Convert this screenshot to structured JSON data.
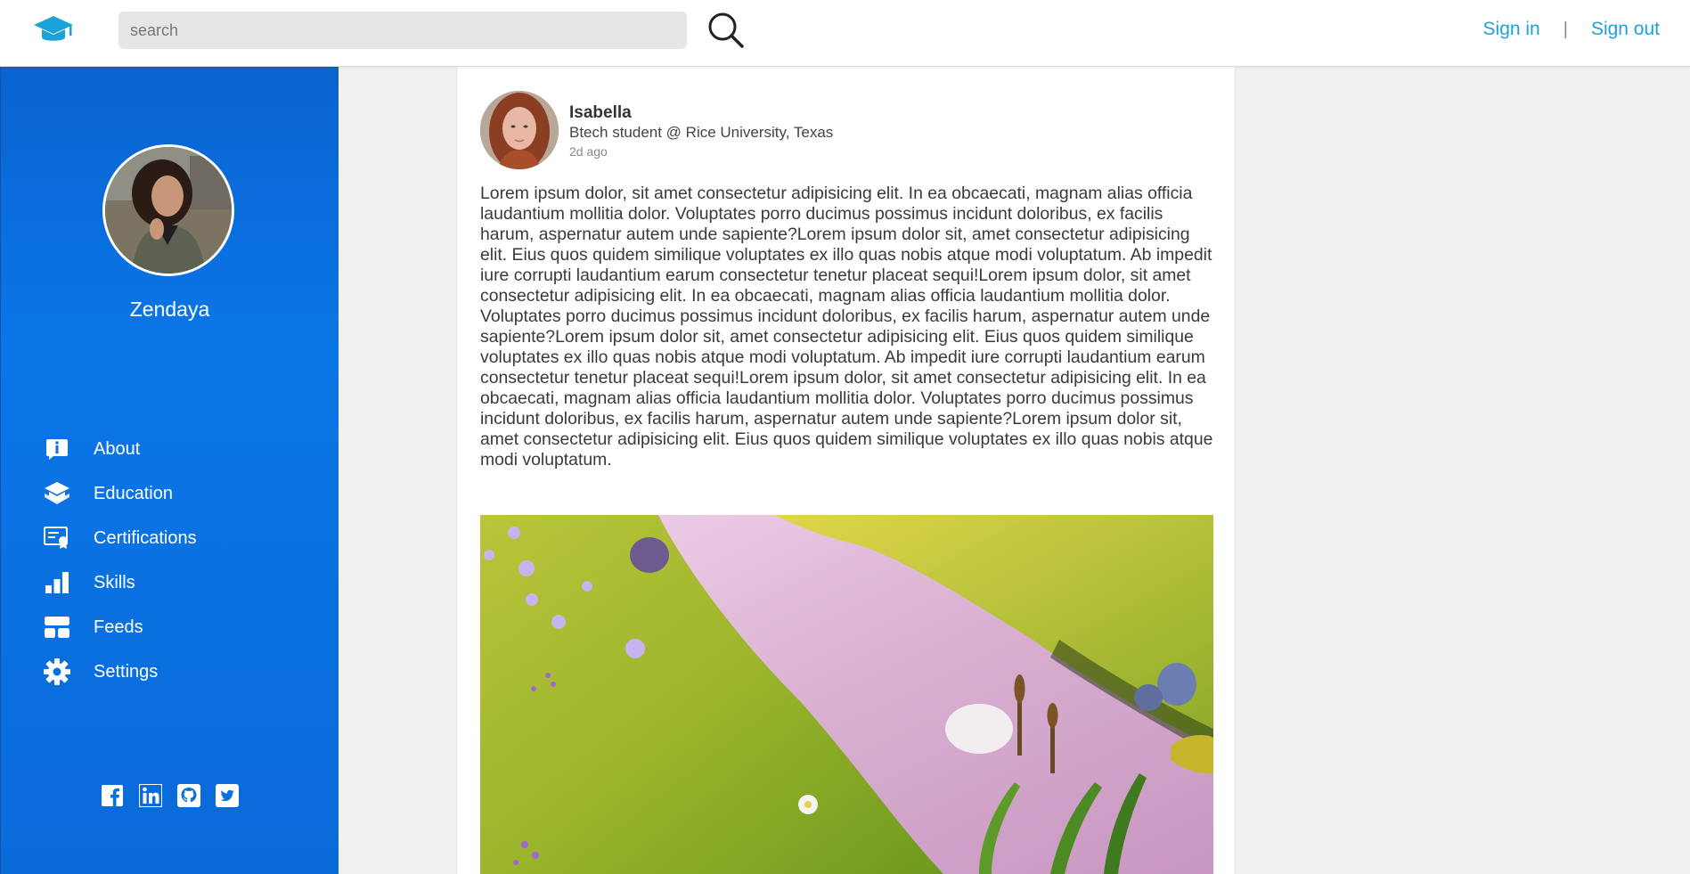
{
  "header": {
    "search_placeholder": "search",
    "sign_in": "Sign in",
    "separator": "|",
    "sign_out": "Sign out"
  },
  "sidebar": {
    "profile_name": "Zendaya",
    "items": [
      {
        "label": "About",
        "icon": "info-icon"
      },
      {
        "label": "Education",
        "icon": "graduation-cap-icon"
      },
      {
        "label": "Certifications",
        "icon": "certificate-icon"
      },
      {
        "label": "Skills",
        "icon": "bar-chart-icon"
      },
      {
        "label": "Feeds",
        "icon": "feed-icon"
      },
      {
        "label": "Settings",
        "icon": "gear-icon"
      }
    ],
    "social": [
      "facebook-icon",
      "linkedin-icon",
      "github-icon",
      "twitter-icon"
    ]
  },
  "post": {
    "author_name": "Isabella",
    "author_title": "Btech student @ Rice University, Texas",
    "time": "2d ago",
    "body": "Lorem ipsum dolor, sit amet consectetur adipisicing elit. In ea obcaecati, magnam alias officia laudantium mollitia dolor. Voluptates porro ducimus possimus incidunt doloribus, ex facilis harum, aspernatur autem unde sapiente?Lorem ipsum dolor sit, amet consectetur adipisicing elit. Eius quos quidem similique voluptates ex illo quas nobis atque modi voluptatum. Ab impedit iure corrupti laudantium earum consectetur tenetur placeat sequi!Lorem ipsum dolor, sit amet consectetur adipisicing elit. In ea obcaecati, magnam alias officia laudantium mollitia dolor. Voluptates porro ducimus possimus incidunt doloribus, ex facilis harum, aspernatur autem unde sapiente?Lorem ipsum dolor sit, amet consectetur adipisicing elit. Eius quos quidem similique voluptates ex illo quas nobis atque modi voluptatum. Ab impedit iure corrupti laudantium earum consectetur tenetur placeat sequi!Lorem ipsum dolor, sit amet consectetur adipisicing elit. In ea obcaecati, magnam alias officia laudantium mollitia dolor. Voluptates porro ducimus possimus incidunt doloribus, ex facilis harum, aspernatur autem unde sapiente?Lorem ipsum dolor sit, amet consectetur adipisicing elit. Eius quos quidem similique voluptates ex illo quas nobis atque modi voluptatum."
  },
  "colors": {
    "sidebar": "#0b76e8",
    "link": "#1aa3d9",
    "logo": "#1aa3d9"
  }
}
